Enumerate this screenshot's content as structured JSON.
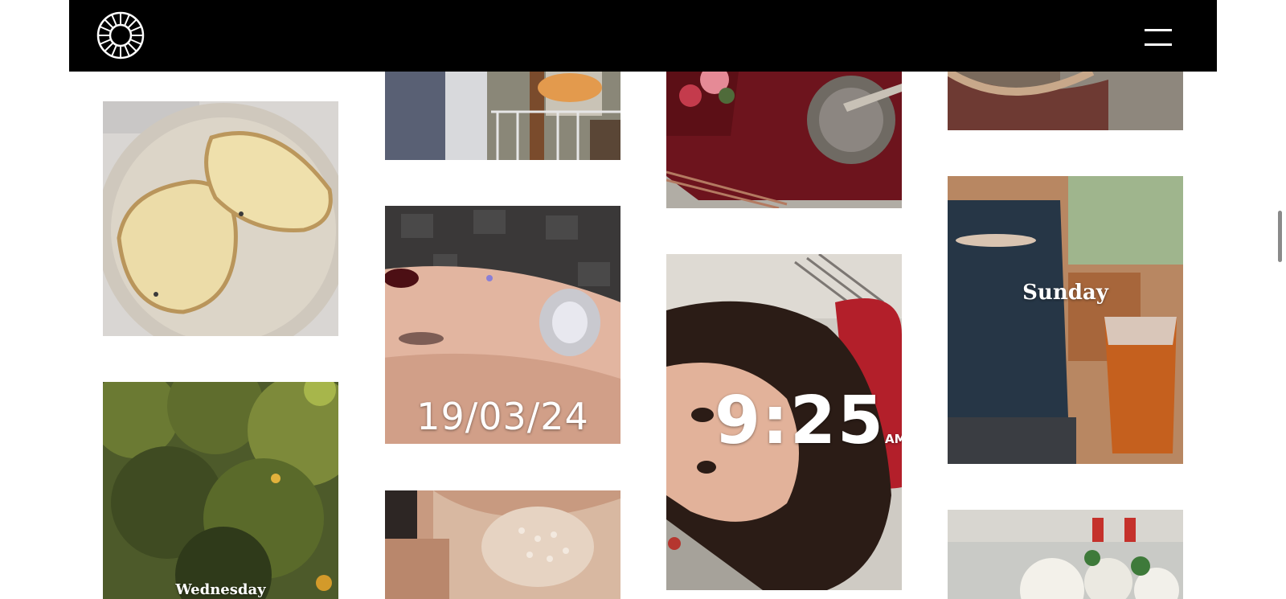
{
  "header": {
    "logo_icon": "vsco-logo-icon",
    "menu_icon": "hamburger-menu-icon",
    "background": "#000000"
  },
  "gallery": {
    "captions": {
      "date_stamp": "19/03/24",
      "clock_time": "9:25",
      "clock_ampm": "AM",
      "sunday": "Sunday",
      "wednesday": "Wednesday"
    }
  }
}
